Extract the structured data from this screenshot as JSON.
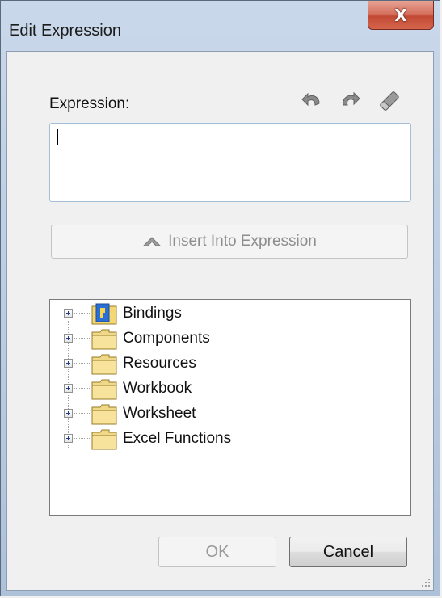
{
  "window": {
    "title": "Edit Expression",
    "close_label": "X"
  },
  "expression": {
    "label": "Expression:",
    "value": "",
    "toolbar_icons": [
      "undo-icon",
      "redo-icon",
      "eraser-icon"
    ]
  },
  "insert_button": {
    "icon": "chevron-up-icon",
    "label": "Insert Into Expression"
  },
  "tree": {
    "items": [
      {
        "label": "Bindings",
        "icon": "binding-folder-icon"
      },
      {
        "label": "Components",
        "icon": "folder-icon"
      },
      {
        "label": "Resources",
        "icon": "folder-icon"
      },
      {
        "label": "Workbook",
        "icon": "folder-icon"
      },
      {
        "label": "Worksheet",
        "icon": "folder-icon"
      },
      {
        "label": "Excel Functions",
        "icon": "folder-icon"
      }
    ]
  },
  "buttons": {
    "ok_label": "OK",
    "cancel_label": "Cancel"
  },
  "colors": {
    "frame": "#b9cbe0",
    "close_button": "#c24a34",
    "folder": "#f3d775",
    "binding_badge": "#2b6fd6"
  }
}
